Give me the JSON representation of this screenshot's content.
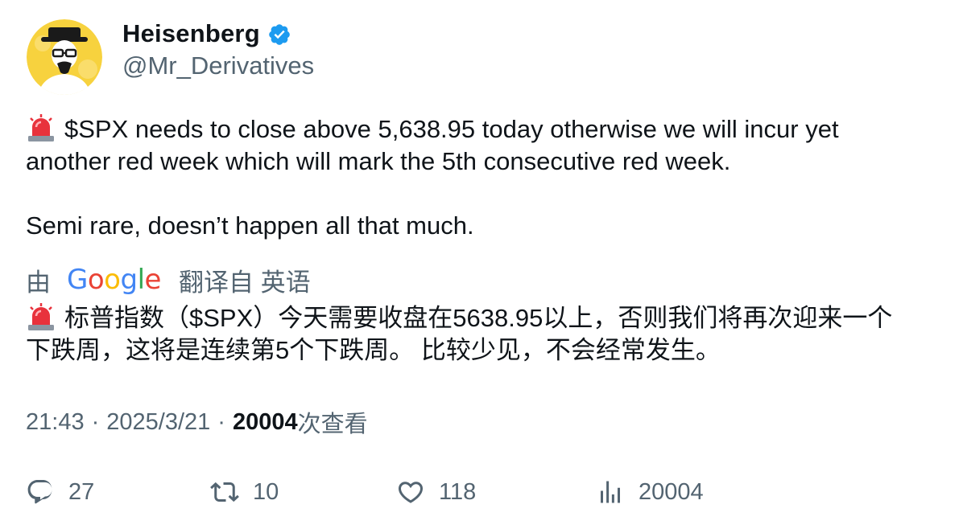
{
  "author": {
    "display_name": "Heisenberg",
    "handle": "@Mr_Derivatives",
    "verified": true,
    "verified_color": "#1d9bf0",
    "avatar_icon": "heisenberg-avatar"
  },
  "tweet": {
    "emoji_icon": "police-siren-icon",
    "line1": "$SPX needs to close above 5,638.95 today otherwise we will incur yet",
    "line2": "another red week which will mark the 5th consecutive red week.",
    "line3": "Semi rare, doesn’t happen all that much."
  },
  "translation": {
    "prefix": "由",
    "brand": "Google",
    "suffix": "翻译自 英语",
    "line1": "标普指数（$SPX）今天需要收盘在5638.95以上，否则我们将再次迎来一个",
    "line2": "下跌周，这将是连续第5个下跌周。 比较少见，不会经常发生。"
  },
  "meta": {
    "time": "21:43",
    "date": "2025/3/21",
    "views": "20004",
    "views_label": "次查看"
  },
  "actions": {
    "replies": "27",
    "retweets": "10",
    "likes": "118",
    "views": "20004"
  },
  "colors": {
    "text": "#0f1419",
    "secondary": "#536471",
    "avatar_bg": "#f7d23e"
  }
}
